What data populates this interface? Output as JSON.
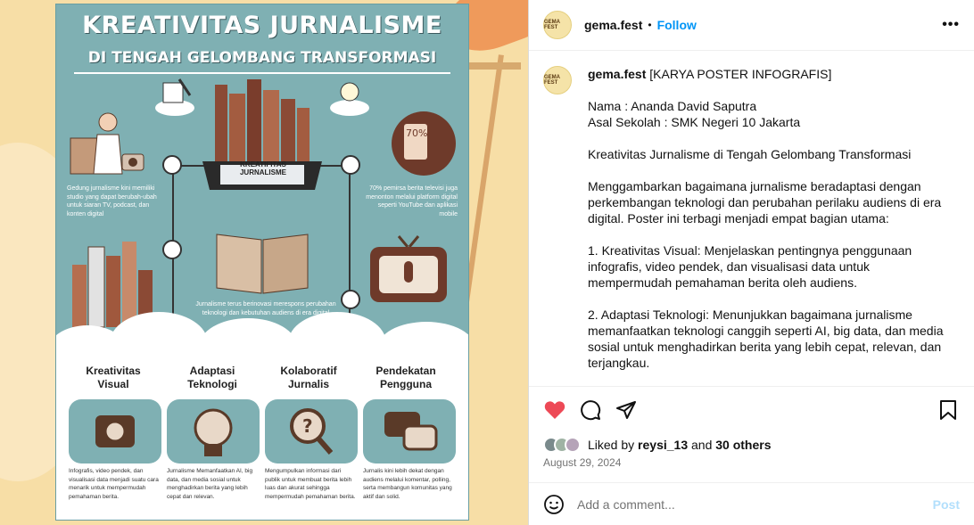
{
  "post": {
    "username": "gema.fest",
    "follow_label": "Follow",
    "more_label": "•••",
    "avatar_text": "GEMA FEST"
  },
  "poster": {
    "title": "KREATIVITAS JURNALISME",
    "subtitle": "DI TENGAH GELOMBANG TRANSFORMASI",
    "tablet_label": "KREATIFITAS JURNALISME",
    "text_left": "Gedung jurnalisme kini memiliki studio yang dapat berubah-ubah untuk siaran TV, podcast, dan konten digital",
    "text_right": "70% pemirsa berita televisi juga menonton melalui platform digital seperti YouTube dan aplikasi mobile",
    "text_center": "Jurnalisme terus berinovasi merespons perubahan teknologi dan kebutuhan audiens di era digital",
    "columns": [
      {
        "title": "Kreativitas Visual",
        "text": "Infografis, video pendek, dan visualisasi data menjadi suatu cara menarik untuk mempermudah pemahaman berita."
      },
      {
        "title": "Adaptasi Teknologi",
        "text": "Jurnalisme Memanfaatkan AI, big data, dan media sosial untuk menghadirkan berita yang lebih cepat dan relevan."
      },
      {
        "title": "Kolaboratif Jurnalis",
        "text": "Mengumpulkan informasi dari publik untuk membuat berita lebih luas dan akurat sehingga mempermudah pemahaman berita."
      },
      {
        "title": "Pendekatan Pengguna",
        "text": "Jurnalis kini lebih dekat dengan audiens melalui komentar, polling, serta membangun komunitas yang aktif dan solid."
      }
    ]
  },
  "caption": {
    "username": "gema.fest",
    "lines": [
      "[KARYA POSTER INFOGRAFIS]",
      "",
      "Nama : Ananda David Saputra",
      "Asal Sekolah : SMK Negeri 10 Jakarta",
      "",
      "Kreativitas Jurnalisme di Tengah Gelombang Transformasi",
      "",
      "Menggambarkan bagaimana jurnalisme beradaptasi dengan perkembangan teknologi dan perubahan perilaku audiens di era digital. Poster ini terbagi menjadi empat bagian utama:",
      "",
      "1. Kreativitas Visual: Menjelaskan pentingnya penggunaan infografis, video pendek, dan visualisasi data untuk mempermudah pemahaman berita oleh audiens.",
      "",
      "2. Adaptasi Teknologi: Menunjukkan bagaimana jurnalisme memanfaatkan teknologi canggih seperti AI, big data, dan media sosial untuk menghadirkan berita yang lebih cepat, relevan, dan terjangkau."
    ]
  },
  "likes": {
    "prefix": "Liked by ",
    "user": "reysi_13",
    "middle": " and ",
    "others": "30 others"
  },
  "date": "August 29, 2024",
  "comment": {
    "placeholder": "Add a comment...",
    "post_label": "Post"
  },
  "colors": {
    "poster_bg": "#7fb0b3",
    "like_red": "#ed4956",
    "link_blue": "#0095f6"
  }
}
